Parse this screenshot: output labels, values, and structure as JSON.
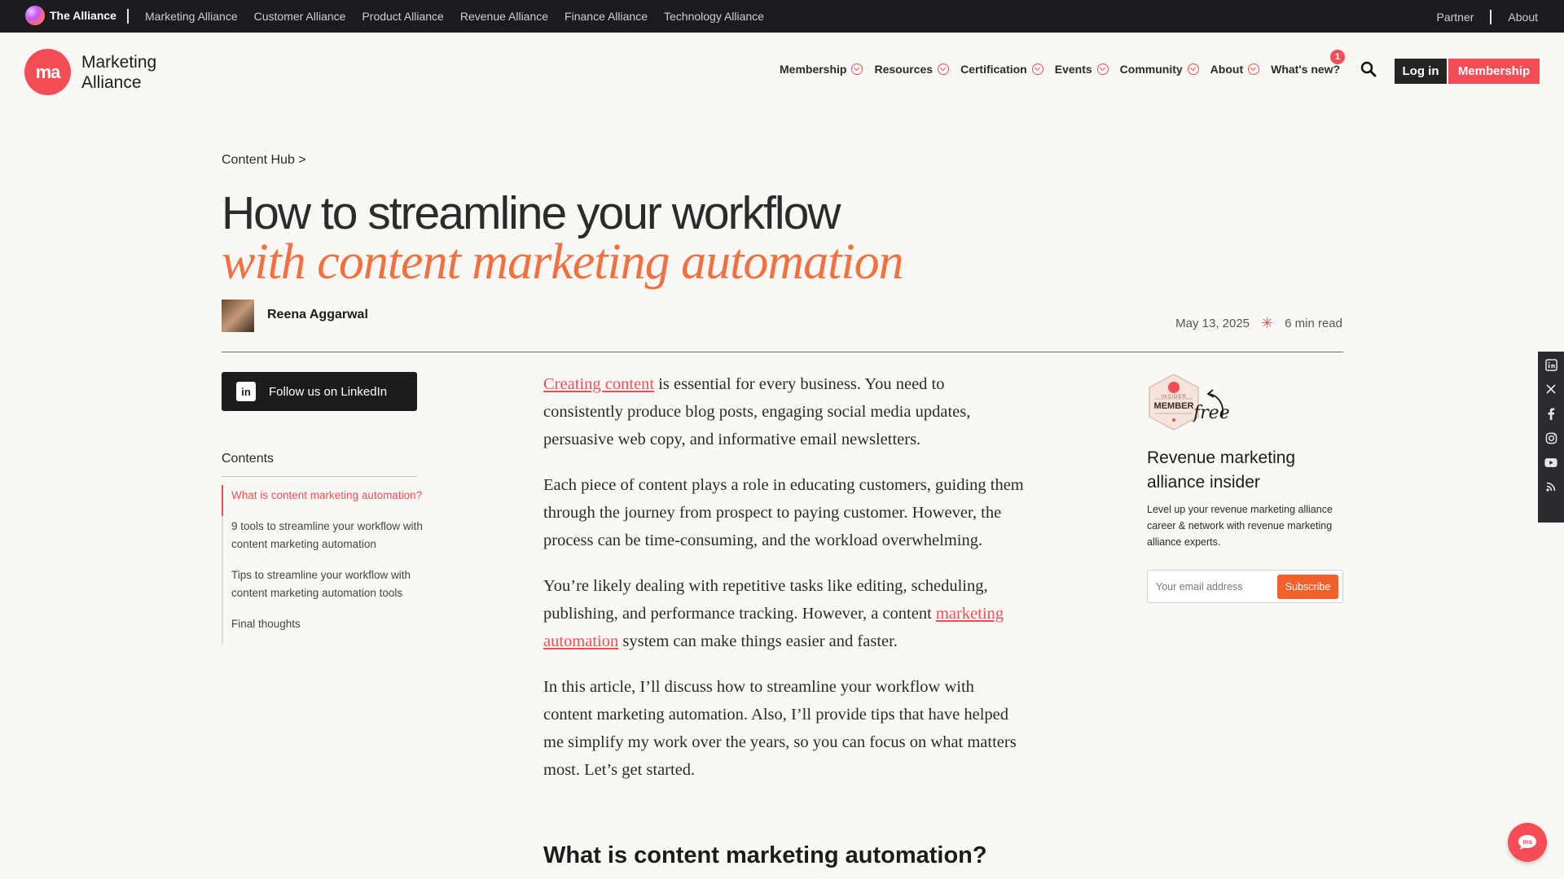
{
  "topbar": {
    "brand": "The Alliance",
    "links": [
      "Marketing Alliance",
      "Customer Alliance",
      "Product Alliance",
      "Revenue Alliance",
      "Finance Alliance",
      "Technology Alliance"
    ],
    "right": [
      "Partner",
      "About"
    ]
  },
  "logo": {
    "mark": "ma",
    "line1": "Marketing",
    "line2": "Alliance"
  },
  "nav": {
    "items": [
      "Membership",
      "Resources",
      "Certification",
      "Events",
      "Community",
      "About"
    ],
    "whats_new": "What's new?",
    "whats_new_badge": "1",
    "login": "Log in",
    "membership": "Membership"
  },
  "article": {
    "breadcrumb": "Content Hub >",
    "title_line1": "How to streamline your workflow",
    "title_line2": "with content marketing automation",
    "author": "Reena Aggarwal",
    "date": "May 13, 2025",
    "read_time": "6 min read",
    "p1_link": "Creating content",
    "p1_rest": " is essential for every business. You need to consistently produce blog posts, engaging social media updates, persuasive web copy, and informative email newsletters.",
    "p2": "Each piece of content plays a role in educating customers, guiding them through the journey from prospect to paying customer. However, the process can be time-consuming, and the workload overwhelming.",
    "p3_start": "You’re likely dealing with repetitive tasks like editing, scheduling, publishing, and performance tracking. However, a content ",
    "p3_link": "marketing automation",
    "p3_end": " system can make things easier and faster.",
    "p4": "In this article, I’ll discuss how to streamline your workflow with content marketing automation. Also, I’ll provide tips that have helped me simplify my work over the years, so you can focus on what matters most. Let’s get started.",
    "h2": "What is content marketing automation?"
  },
  "sidebar_left": {
    "linkedin_label": "Follow us on LinkedIn",
    "contents_title": "Contents",
    "toc": [
      "What is content marketing automation?",
      "9 tools to streamline your workflow with content marketing automation",
      "Tips to streamline your workflow with content marketing automation tools",
      "Final thoughts"
    ]
  },
  "sidebar_right": {
    "badge_top": "INSIDER",
    "badge_main": "MEMBER",
    "free": "free",
    "title": "Revenue marketing alliance insider",
    "description": "Level up your revenue marketing alliance career & network with revenue marketing alliance experts.",
    "email_placeholder": "Your email address",
    "subscribe": "Subscribe"
  },
  "social_icons": [
    "linkedin-icon",
    "x-icon",
    "facebook-icon",
    "instagram-icon",
    "youtube-icon",
    "rss-icon"
  ],
  "colors": {
    "accent": "#f44d56",
    "title_orange": "#f2703f",
    "dark": "#1b1c1f"
  }
}
